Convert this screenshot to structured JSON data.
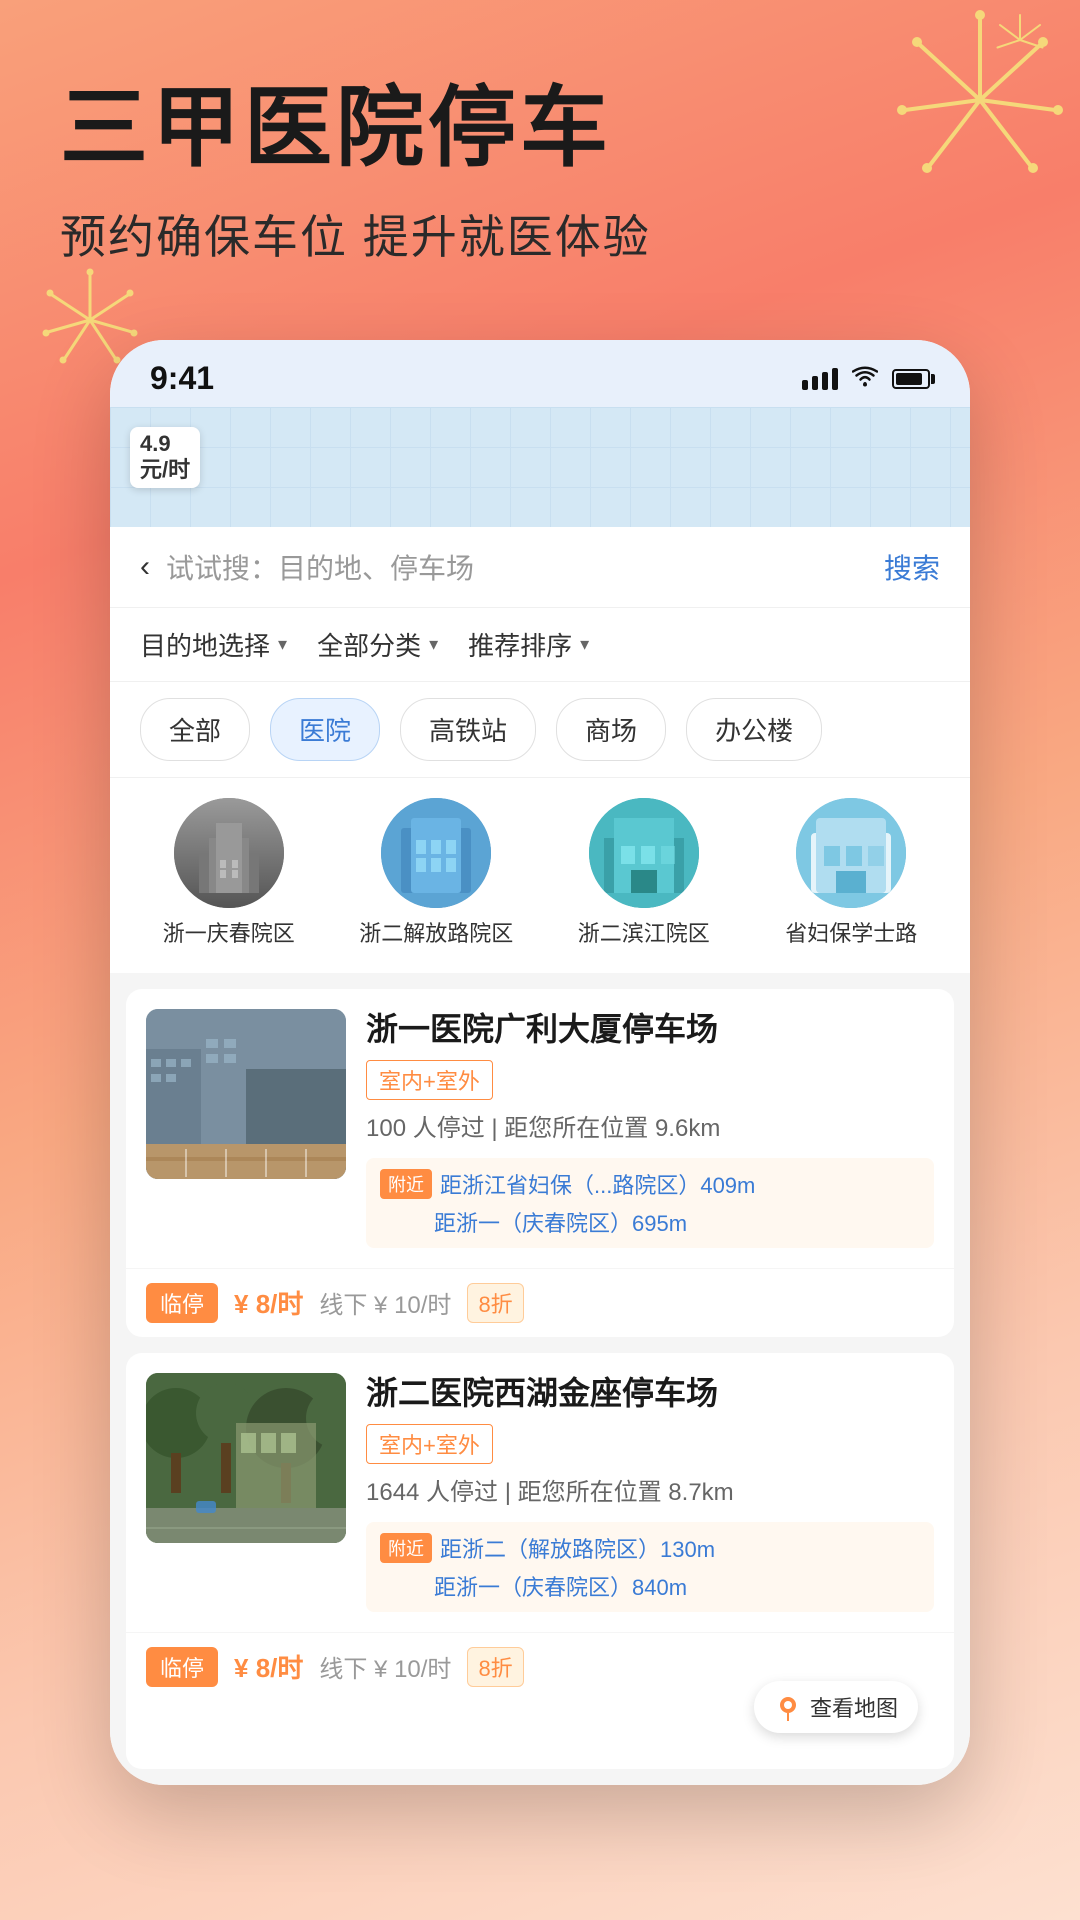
{
  "hero": {
    "title": "三甲医院停车",
    "subtitle": "预约确保车位  提升就医体验"
  },
  "status_bar": {
    "time": "9:41",
    "signal": "signal",
    "wifi": "wifi",
    "battery": "battery"
  },
  "search": {
    "placeholder": "试试搜：目的地、停车场",
    "button": "搜索",
    "back_icon": "‹"
  },
  "filters": [
    {
      "label": "目的地选择",
      "id": "destination"
    },
    {
      "label": "全部分类",
      "id": "category"
    },
    {
      "label": "推荐排序",
      "id": "sort"
    }
  ],
  "categories": [
    {
      "label": "全部",
      "active": false
    },
    {
      "label": "医院",
      "active": true
    },
    {
      "label": "高铁站",
      "active": false
    },
    {
      "label": "商场",
      "active": false
    },
    {
      "label": "办公楼",
      "active": false
    }
  ],
  "hospitals": [
    {
      "name": "浙一庆春院区",
      "id": "h1"
    },
    {
      "name": "浙二解放路院区",
      "id": "h2"
    },
    {
      "name": "浙二滨江院区",
      "id": "h3"
    },
    {
      "name": "省妇保学士路",
      "id": "h4"
    }
  ],
  "parking_lots": [
    {
      "id": "p1",
      "name": "浙一医院广利大厦停车场",
      "type": "室内+室外",
      "visitors": "100 人停过",
      "distance": "距您所在位置 9.6km",
      "nearby": [
        {
          "text": "距浙江省妇保（...路院区）409m"
        },
        {
          "text": "距浙一（庆春院区）695m"
        }
      ],
      "nearby_badge": "附近",
      "price_tag": "临停",
      "price": "¥ 8/时",
      "price_label": "线下 ¥ 10/时",
      "discount": "8折"
    },
    {
      "id": "p2",
      "name": "浙二医院西湖金座停车场",
      "type": "室内+室外",
      "visitors": "1644 人停过",
      "distance": "距您所在位置 8.7km",
      "nearby": [
        {
          "text": "距浙二（解放路院区）130m"
        },
        {
          "text": "距浙一（庆春院区）840m"
        }
      ],
      "nearby_badge": "附近",
      "price_tag": "临停",
      "price": "¥ 8/时",
      "price_label": "线下 ¥ 10/时",
      "discount": "8折",
      "map_btn": "查看地图"
    }
  ],
  "map_price": {
    "value": "4.9",
    "unit": "元/时"
  }
}
